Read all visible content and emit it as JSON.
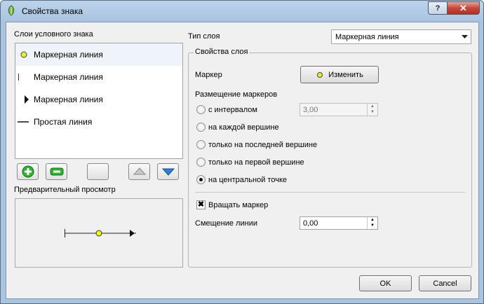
{
  "window": {
    "title": "Свойства знака",
    "help_glyph": "?",
    "close_glyph": "✕"
  },
  "layers": {
    "label": "Слои условного знака",
    "items": [
      {
        "label": "Маркерная линия",
        "symbol": "yellow-dot-icon",
        "selected": true
      },
      {
        "label": "Маркерная линия",
        "symbol": "tick-mark-icon",
        "selected": false
      },
      {
        "label": "Маркерная линия",
        "symbol": "arrow-right-icon",
        "selected": false
      },
      {
        "label": "Простая линия",
        "symbol": "line-icon",
        "selected": false
      }
    ],
    "toolbar": [
      "add-layer-icon",
      "remove-layer-icon",
      "lock-icon",
      "move-up-icon",
      "move-down-icon"
    ]
  },
  "preview": {
    "label": "Предварительный просмотр"
  },
  "layer_type": {
    "label": "Тип слоя",
    "value": "Маркерная линия"
  },
  "properties": {
    "title": "Свойства слоя",
    "marker_label": "Маркер",
    "change_button": "Изменить",
    "placement_label": "Размещение маркеров",
    "options": [
      {
        "label": "с интервалом",
        "checked": false
      },
      {
        "label": "на каждой вершине",
        "checked": false
      },
      {
        "label": "только на последней вершине",
        "checked": false
      },
      {
        "label": "только на первой вершине",
        "checked": false
      },
      {
        "label": "на центральной точке",
        "checked": true
      }
    ],
    "interval_value": "3,00",
    "rotate_label": "Вращать маркер",
    "rotate_checked": true,
    "offset_label": "Смещение линии",
    "offset_value": "0,00"
  },
  "buttons": {
    "ok": "OK",
    "cancel": "Cancel"
  },
  "colors": {
    "marker_fill": "#f2f21a",
    "accent_blue": "#2f7fd8",
    "add_green": "#2db52d"
  }
}
